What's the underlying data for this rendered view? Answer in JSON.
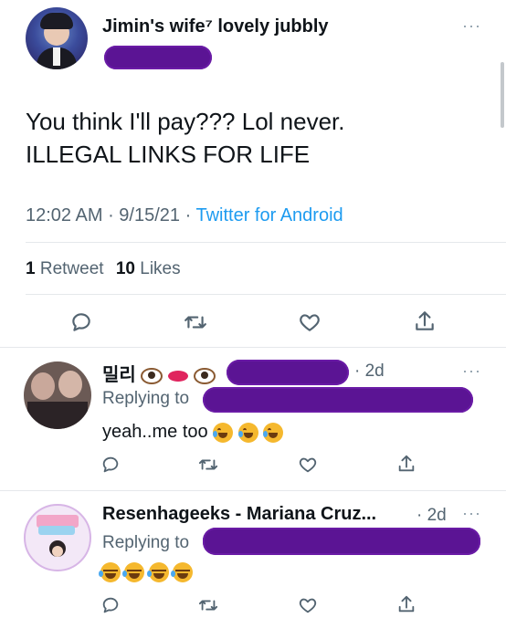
{
  "main_tweet": {
    "display_name": "Jimin's wife⁷ lovely jubbly",
    "text_line1": "You think I'll pay??? Lol never.",
    "text_line2": "ILLEGAL LINKS FOR LIFE",
    "time": "12:02 AM",
    "date": "9/15/21",
    "source": "Twitter for Android",
    "retweet_count": "1",
    "retweet_label": "Retweet",
    "like_count": "10",
    "like_label": "Likes",
    "more": "···"
  },
  "replies": [
    {
      "display_name": "밀리",
      "age": "· 2d",
      "replying_label": "Replying to",
      "text": "yeah..me too",
      "emojis": [
        "rolling-on-floor-laughing",
        "rolling-on-floor-laughing",
        "rolling-on-floor-laughing"
      ],
      "more": "···"
    },
    {
      "display_name": "Resenhageeks - Mariana Cruz...",
      "age": "· 2d",
      "replying_label": "Replying to",
      "text": "",
      "emojis": [
        "face-with-tears-of-joy",
        "face-with-tears-of-joy",
        "face-with-tears-of-joy",
        "face-with-tears-of-joy"
      ],
      "more": "···"
    }
  ],
  "colors": {
    "accent": "#1d9bf0",
    "muted": "#536471",
    "redaction": "#5b1494"
  }
}
